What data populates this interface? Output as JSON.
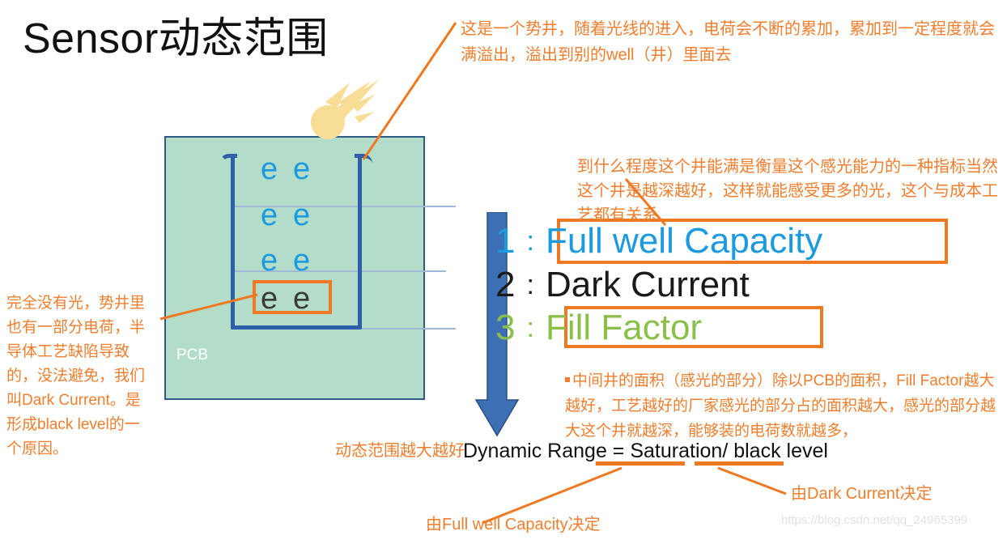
{
  "slide": {
    "title": "Sensor动态范围"
  },
  "diagram": {
    "pcb_label": "PCB",
    "electron_glyph": "e",
    "electrons_blue_count": 6,
    "electrons_dark_count": 2,
    "light_icon": "comet-light-ray-icon",
    "arrow_icon": "down-arrow-icon",
    "colors": {
      "pcb_fill": "#b4ddc9",
      "pcb_border": "#2e5a86",
      "well_stroke": "#2e5fa8",
      "electron_blue": "#1c9ae0",
      "electron_dark": "#3a3a3a",
      "highlight_orange": "#ef7922",
      "level_line": "#9fb9d6",
      "arrow_blue": "#3d6fb5",
      "light_yellow": "#f7dd96"
    }
  },
  "list": {
    "items": [
      {
        "num": "1",
        "colon": ":",
        "label": "Full well Capacity",
        "color": "#1c9ae0",
        "boxed": true
      },
      {
        "num": "2",
        "colon": ":",
        "label": "Dark Current",
        "color": "#1a1a1a",
        "boxed": false
      },
      {
        "num": "3",
        "colon": ":",
        "label": "Fill Factor",
        "color": "#8cbf4a",
        "boxed": true
      }
    ]
  },
  "equation": {
    "text": "Dynamic Range = Saturation/ black level",
    "underlined_terms": [
      "Saturation",
      "black level"
    ]
  },
  "annotations": {
    "top_right": "这是一个势井，随着光线的进入，电荷会不断的累加，累加到一定程度就会满溢出，溢出到别的well（井）里面去",
    "right_middle": "到什么程度这个井能满是衡量这个感光能力的一种指标当然这个井是越深越好，这样就能感受更多的光，这个与成本工艺都有关系",
    "left_side": "完全没有光，势井里也有一部分电荷，半导体工艺缺陷导致的，没法避免，我们叫Dark Current。是形成black level的一个原因。",
    "fill_factor": "中间井的面积（感光的部分）除以PCB的面积，Fill Factor越大越好，工艺越好的厂家感光的部分占的面积越大，感光的部分越大这个井就越深，能够装的电荷数就越多，",
    "dynamic_range": "动态范围越大越好",
    "by_full_well": "由Full well Capacity决定",
    "by_dark_current": "由Dark Current决定",
    "color": "#ef7e2e"
  },
  "watermark": {
    "text": "https://blog.csdn.net/qq_24965399"
  }
}
